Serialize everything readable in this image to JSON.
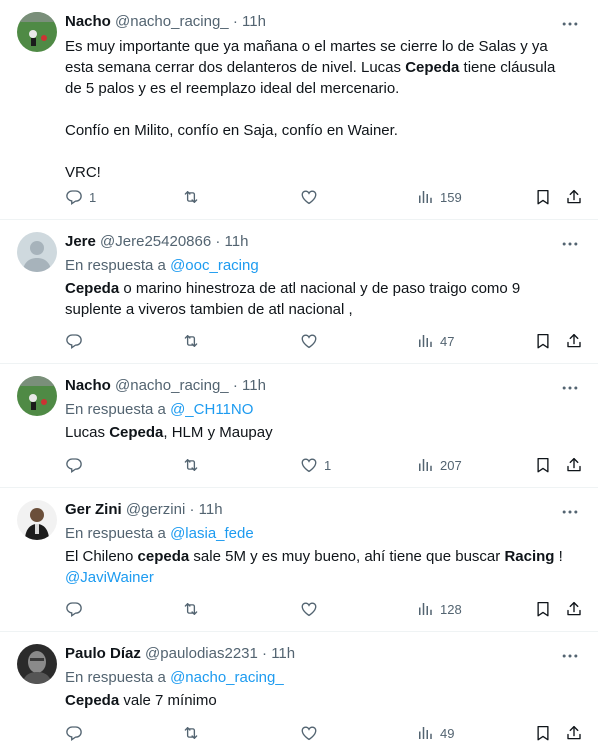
{
  "tweets": [
    {
      "name": "Nacho",
      "handle": "@nacho_racing_",
      "time": "11h",
      "reply_label": "",
      "reply_handle": "",
      "body": {
        "l1": "Es muy importante que ya mañana o el martes se cierre lo de Salas y ya",
        "l2": "esta semana cerrar dos delanteros de nivel. Lucas ",
        "l2b": "Cepeda",
        "l2c": " tiene cláusula",
        "l3": "de 5 palos y es el reemplazo ideal del mercenario.",
        "l4": "Confío en Milito, confío en Saja, confío en Wainer.",
        "l5": "VRC!"
      },
      "counts": {
        "reply": "1",
        "retweet": "",
        "like": "",
        "views": "159"
      }
    },
    {
      "name": "Jere",
      "handle": "@Jere25420866",
      "time": "11h",
      "reply_label": "En respuesta a",
      "reply_handle": "@ooc_racing",
      "body": {
        "l1a": "Cepeda",
        "l1b": " o marino hinestroza de atl nacional y de paso traigo como 9",
        "l2": "suplente a viveros  tambien de atl nacional ,"
      },
      "counts": {
        "reply": "",
        "retweet": "",
        "like": "",
        "views": "47"
      }
    },
    {
      "name": "Nacho",
      "handle": "@nacho_racing_",
      "time": "11h",
      "reply_label": "En respuesta a",
      "reply_handle": "@_CH11NO",
      "body": {
        "l1a": "Lucas ",
        "l1b": "Cepeda",
        "l1c": ", HLM y Maupay"
      },
      "counts": {
        "reply": "",
        "retweet": "",
        "like": "1",
        "views": "207"
      }
    },
    {
      "name": "Ger Zini",
      "handle": "@gerzini",
      "time": "11h",
      "reply_label": "En respuesta a",
      "reply_handle": "@lasia_fede",
      "body": {
        "l1a": "El Chileno ",
        "l1b": "cepeda",
        "l1c": " sale 5M y es muy bueno, ahí tiene que buscar ",
        "l1d": "Racing",
        "l1e": " !",
        "l2": "@JaviWainer"
      },
      "counts": {
        "reply": "",
        "retweet": "",
        "like": "",
        "views": "128"
      }
    },
    {
      "name": "Paulo Díaz",
      "handle": "@paulodias2231",
      "time": "11h",
      "reply_label": "En respuesta a",
      "reply_handle": "@nacho_racing_",
      "body": {
        "l1a": "Cepeda",
        "l1b": " vale 7 mínimo"
      },
      "counts": {
        "reply": "",
        "retweet": "",
        "like": "",
        "views": "49"
      }
    }
  ],
  "sep": "·",
  "icons": {
    "more": "more-icon",
    "reply": "reply-icon",
    "retweet": "retweet-icon",
    "like": "heart-icon",
    "views": "views-icon",
    "bookmark": "bookmark-icon",
    "share": "share-icon"
  },
  "colors": {
    "text": "#0f1419",
    "muted": "#536471",
    "link": "#1d9bf0",
    "divider": "#eff3f4"
  }
}
